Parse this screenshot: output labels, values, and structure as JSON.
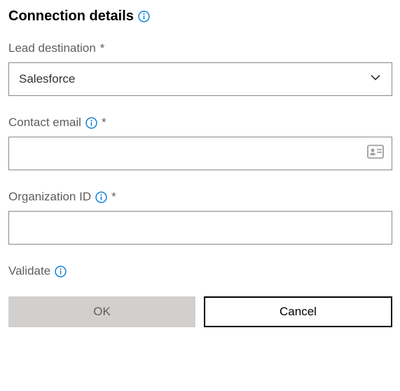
{
  "header": {
    "title": "Connection details"
  },
  "fields": {
    "lead_destination": {
      "label": "Lead destination",
      "required_marker": "*",
      "value": "Salesforce"
    },
    "contact_email": {
      "label": "Contact email",
      "required_marker": "*",
      "value": ""
    },
    "organization_id": {
      "label": "Organization ID",
      "required_marker": "*",
      "value": ""
    }
  },
  "validate": {
    "label": "Validate"
  },
  "buttons": {
    "ok": "OK",
    "cancel": "Cancel"
  },
  "icons": {
    "info": "info-icon",
    "chevron_down": "chevron-down-icon",
    "contact_card": "contact-card-icon"
  }
}
